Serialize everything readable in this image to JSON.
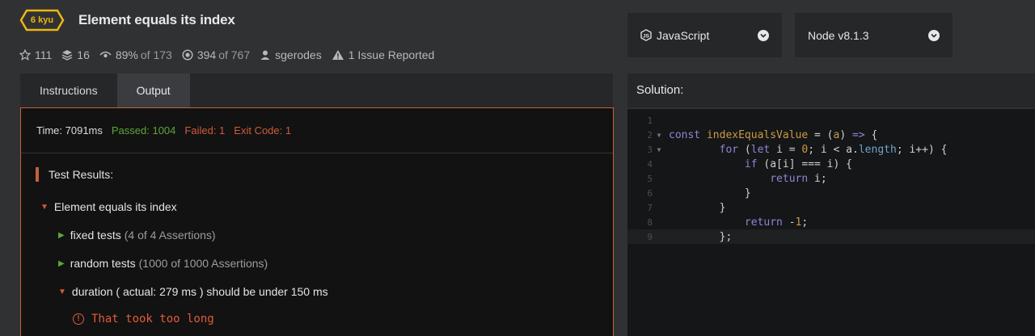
{
  "kata": {
    "rank": "6 kyu",
    "title": "Element equals its index"
  },
  "stats": {
    "stars": "111",
    "collections": "16",
    "satisfaction_pct": "89%",
    "satisfaction_of": "of 173",
    "completed": "394",
    "completed_of": "of 767",
    "author": "sgerodes",
    "issues": "1 Issue Reported"
  },
  "language_select": {
    "label": "JavaScript"
  },
  "version_select": {
    "label": "Node v8.1.3"
  },
  "tabs": [
    {
      "label": "Instructions",
      "active": false
    },
    {
      "label": "Output",
      "active": true
    }
  ],
  "output": {
    "time": "Time: 7091ms",
    "passed": "Passed: 1004",
    "failed": "Failed: 1",
    "exit_code": "Exit Code: 1",
    "results_title": "Test Results:",
    "suite": "Element equals its index",
    "tests": [
      {
        "name": "fixed tests",
        "detail": "(4 of 4 Assertions)",
        "status": "passed"
      },
      {
        "name": "random tests",
        "detail": "(1000 of 1000 Assertions)",
        "status": "passed"
      },
      {
        "name": "duration ( actual: 279 ms ) should be under 150 ms",
        "detail": "",
        "status": "failed"
      }
    ],
    "error_message": "That took too long"
  },
  "solution": {
    "header": "Solution:",
    "line_numbers": [
      "1",
      "2",
      "3",
      "4",
      "5",
      "6",
      "7",
      "8",
      "9"
    ]
  },
  "colors": {
    "accent_border": "#c6603f",
    "passed": "#5ea43a",
    "failed": "#cf5a3a",
    "rank_badge": "#ecb613"
  }
}
